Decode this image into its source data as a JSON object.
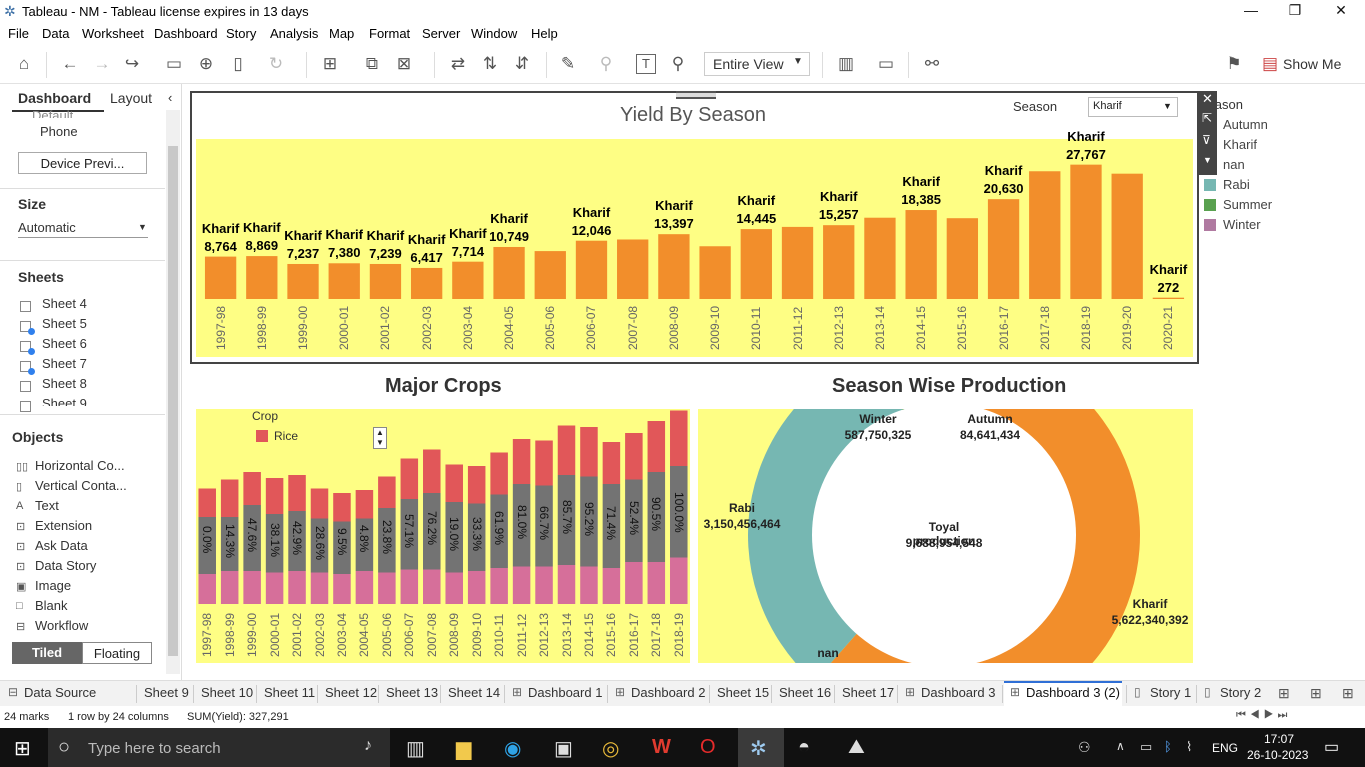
{
  "window": {
    "title": "Tableau - NM - Tableau license expires in 13 days"
  },
  "menu": [
    "File",
    "Data",
    "Worksheet",
    "Dashboard",
    "Story",
    "Analysis",
    "Map",
    "Format",
    "Server",
    "Window",
    "Help"
  ],
  "toolbar": {
    "fit_mode": "Entire View",
    "show_me": "Show Me"
  },
  "left_panel": {
    "tab_dashboard": "Dashboard",
    "tab_layout": "Layout",
    "device_default": "Default",
    "device_phone": "Phone",
    "device_preview_button": "Device Previ...",
    "size_heading": "Size",
    "size_value": "Automatic",
    "sheets_heading": "Sheets",
    "sheets": [
      "Sheet 4",
      "Sheet 5",
      "Sheet 6",
      "Sheet 7",
      "Sheet 8",
      "Sheet 9"
    ],
    "objects_heading": "Objects",
    "objects": [
      "Horizontal Co...",
      "Vertical Conta...",
      "Text",
      "Extension",
      "Ask Data",
      "Data Story",
      "Image",
      "Blank",
      "Workflow"
    ],
    "tiled": "Tiled",
    "floating": "Floating"
  },
  "dashboard": {
    "yield_title": "Yield By Season",
    "season_filter_label": "Season",
    "season_filter_value": "Kharif",
    "major_crops_title": "Major Crops",
    "season_production_title": "Season Wise Production",
    "season_legend_title": "Season",
    "season_legend": [
      {
        "name": "Autumn",
        "color": "#fefe84"
      },
      {
        "name": "Kharif",
        "color": "#f28e2b"
      },
      {
        "name": "nan",
        "color": "#555555"
      },
      {
        "name": "Rabi",
        "color": "#76b7b2"
      },
      {
        "name": "Summer",
        "color": "#59a14f"
      },
      {
        "name": "Winter",
        "color": "#b07aa1"
      }
    ],
    "crop_legend_title": "Crop",
    "crop_legend_item": "Rice",
    "crop_legend_color": "#e15759"
  },
  "chart_data": [
    {
      "type": "bar",
      "title": "Yield By Season",
      "categories": [
        "1997-98",
        "1998-99",
        "1999-00",
        "2000-01",
        "2001-02",
        "2002-03",
        "2003-04",
        "2004-05",
        "2005-06",
        "2006-07",
        "2007-08",
        "2008-09",
        "2009-10",
        "2010-11",
        "2011-12",
        "2012-13",
        "2013-14",
        "2014-15",
        "2015-16",
        "2016-17",
        "2017-18",
        "2018-19",
        "2019-20",
        "2020-21"
      ],
      "series": [
        {
          "name": "Kharif",
          "values": [
            8764,
            8869,
            7237,
            7380,
            7239,
            6417,
            7714,
            10749,
            9900,
            12046,
            12300,
            13397,
            10900,
            14445,
            14900,
            15257,
            16800,
            18385,
            16700,
            20630,
            26400,
            27767,
            25900,
            272
          ]
        }
      ],
      "labels": [
        "8,764",
        "8,869",
        "7,237",
        "7,380",
        "7,239",
        "6,417",
        "7,714",
        "10,749",
        "",
        "12,046",
        "",
        "13,397",
        "",
        "14,445",
        "",
        "15,257",
        "",
        "18,385",
        "",
        "20,630",
        "",
        "27,767",
        "",
        "272"
      ],
      "label_series": "Kharif",
      "color": "#f28e2b",
      "ylim": [
        0,
        31000
      ]
    },
    {
      "type": "bar",
      "title": "Major Crops",
      "categories": [
        "1997-98",
        "1998-99",
        "1999-00",
        "2000-01",
        "2001-02",
        "2002-03",
        "2003-04",
        "2004-05",
        "2005-06",
        "2006-07",
        "2007-08",
        "2008-09",
        "2009-10",
        "2010-11",
        "2011-12",
        "2012-13",
        "2013-14",
        "2014-15",
        "2015-16",
        "2016-17",
        "2017-18",
        "2018-19"
      ],
      "series": [
        {
          "name": "Rice",
          "color": "#e15759",
          "values": [
            19,
            25,
            22,
            24,
            24,
            20,
            19,
            19,
            21,
            27,
            29,
            25,
            25,
            28,
            30,
            30,
            33,
            33,
            28,
            31,
            34,
            37
          ]
        },
        {
          "name": "",
          "color": "#737373",
          "values": [
            58,
            58,
            66,
            60,
            62,
            57,
            55,
            57,
            64,
            70,
            74,
            68,
            67,
            73,
            80,
            79,
            86,
            85,
            80,
            83,
            88,
            92
          ]
        },
        {
          "name": "",
          "color": "#d66f9a",
          "values": [
            20,
            22,
            22,
            21,
            22,
            21,
            20,
            22,
            21,
            23,
            23,
            21,
            22,
            24,
            25,
            25,
            26,
            25,
            24,
            28,
            28,
            31
          ]
        }
      ],
      "labels": [
        "0.0%",
        "14.3%",
        "47.6%",
        "38.1%",
        "42.9%",
        "28.6%",
        "9.5%",
        "4.8%",
        "23.8%",
        "57.1%",
        "76.2%",
        "19.0%",
        "33.3%",
        "61.9%",
        "81.0%",
        "66.7%",
        "85.7%",
        "95.2%",
        "71.4%",
        "52.4%",
        "90.5%",
        "100.0%"
      ],
      "ylim": [
        0,
        130
      ]
    },
    {
      "type": "pie",
      "title": "Season Wise Production",
      "slices": [
        {
          "name": "Kharif",
          "value": 5622340392,
          "label": "5,622,340,392",
          "color": "#f28e2b"
        },
        {
          "name": "Rabi",
          "value": 3150456464,
          "label": "3,150,456,464",
          "color": "#76b7b2"
        },
        {
          "name": "Winter",
          "value": 587750325,
          "label": "587,750,325",
          "color": "#59a14f"
        },
        {
          "name": "Autumn",
          "value": 84641434,
          "label": "84,641,434",
          "color": "#fefe84"
        },
        {
          "name": "nan",
          "value": 0,
          "label": "",
          "color": "#555555"
        }
      ],
      "center_title": "Toyal production",
      "center_value": "9,688,954,548"
    }
  ],
  "tabs": [
    "Data Source",
    "Sheet 9",
    "Sheet 10",
    "Sheet 11",
    "Sheet 12",
    "Sheet 13",
    "Sheet 14",
    "Dashboard 1",
    "Dashboard 2",
    "Sheet 15",
    "Sheet 16",
    "Sheet 17",
    "Dashboard 3",
    "Dashboard 3 (2)",
    "Story 1",
    "Story 2"
  ],
  "status": {
    "marks": "24 marks",
    "rows_cols": "1 row by 24 columns",
    "sum": "SUM(Yield): 327,291"
  },
  "taskbar": {
    "search_placeholder": "Type here to search",
    "lang": "ENG",
    "time": "17:07",
    "date": "26-10-2023"
  }
}
